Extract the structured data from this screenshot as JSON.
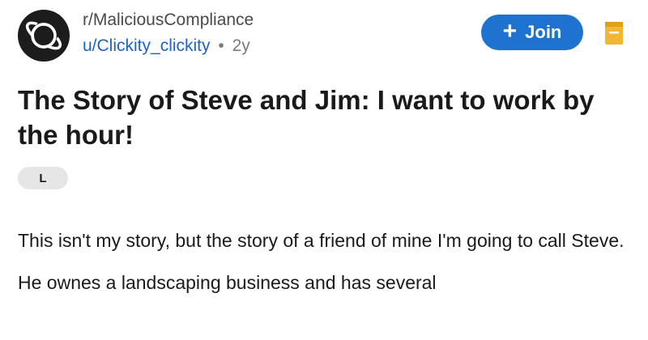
{
  "post": {
    "subreddit": "r/MaliciousCompliance",
    "author": "u/Clickity_clickity",
    "separator": "•",
    "age": "2y",
    "join_label": "Join",
    "title": "The Story of Steve and Jim: I want to work by the hour!",
    "flair": "L",
    "paragraphs": [
      "This isn't my story, but the story of a friend of mine I'm going to call Steve.",
      "He ownes a landscaping business and has several"
    ]
  },
  "colors": {
    "accent": "#1d73cf",
    "username": "#1c64c8",
    "bookmark": "#f2b632"
  },
  "icons": {
    "avatar": "subreddit-planet-icon",
    "join": "plus-icon",
    "bookmark": "bookmark-icon"
  }
}
